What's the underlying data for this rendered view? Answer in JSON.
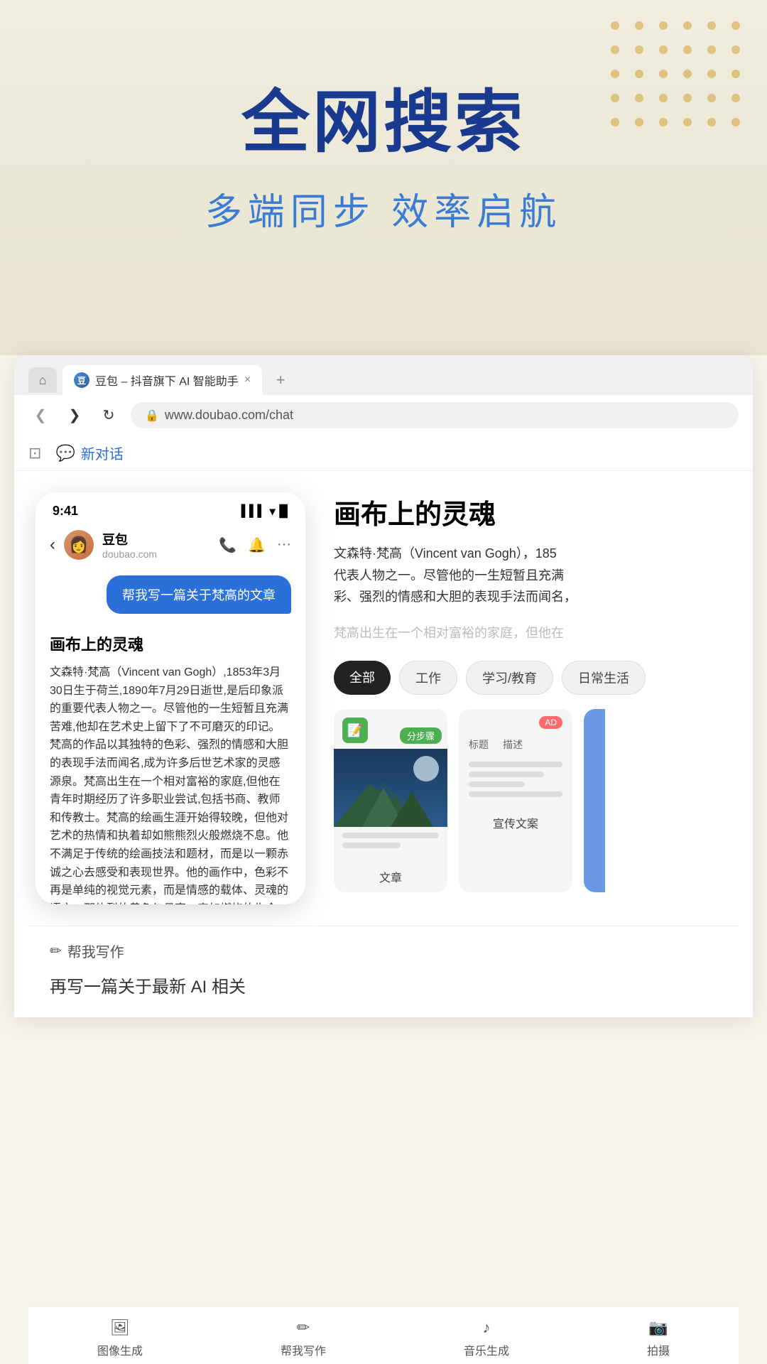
{
  "hero": {
    "title": "全网搜索",
    "subtitle": "多端同步 效率启航",
    "background_color": "#f0ede0"
  },
  "browser": {
    "tab": {
      "title": "豆包 – 抖音旗下 AI 智能助手",
      "favicon": "豆",
      "close_label": "×"
    },
    "new_tab_label": "+",
    "nav": {
      "back_label": "‹",
      "forward_label": "›",
      "refresh_label": "↺",
      "url": "www.doubao.com/chat",
      "lock_icon": "🔒"
    },
    "toolbar": {
      "sidebar_icon": "⊡",
      "new_chat_label": "新对话"
    }
  },
  "phone": {
    "status_bar": {
      "time": "9:41",
      "signal": "▌▌▌",
      "wifi": "▾",
      "battery": "▉"
    },
    "header": {
      "back_label": "‹",
      "contact_name": "豆包",
      "contact_url": "doubao.com"
    },
    "chat_bubble": "帮我写一篇关于梵高的文章",
    "article": {
      "title": "画布上的灵魂",
      "body": "文森特·梵高（Vincent van Gogh）,1853年3月30日生于荷兰,1890年7月29日逝世,是后印象派的重要代表人物之一。尽管他的一生短暂且充满苦难,他却在艺术史上留下了不可磨灭的印记。梵高的作品以其独特的色彩、强烈的情感和大胆的表现手法而闻名,成为许多后世艺术家的灵感源泉。梵高出生在一个相对富裕的家庭,但他在青年时期经历了许多职业尝试,包括书商、教师和传教士。梵高的绘画生涯开始得较晚，但他对艺术的热情和执着却如熊熊烈火般燃烧不息。他不满足于传统的绘画技法和题材，而是以一颗赤诚之心去感受和表现世界。他的画作中，色彩不再是单纯的视觉元素，而是情感的载体、灵魂的语言。那热烈的黄色与月亮，宛如燃烧的生命，仿佛在诉说着"
    }
  },
  "desktop": {
    "article": {
      "title": "画布上的灵魂",
      "body_line1": "文森特·梵高（Vincent van Gogh），185",
      "body_line2": "代表人物之一。尽管他的一生短暂且充满",
      "body_line3": "彩、强烈的情感和大胆的表现手法而闻名，",
      "body_faded": "梵高出生在一个相对富裕的家庭，但他在"
    },
    "tabs": [
      {
        "label": "全部",
        "active": true
      },
      {
        "label": "工作",
        "active": false
      },
      {
        "label": "学习/教育",
        "active": false
      },
      {
        "label": "日常生活",
        "active": false
      }
    ],
    "cards": [
      {
        "type": "image",
        "badge": "分步骤",
        "badge_color": "green",
        "label": "文章",
        "icon": "📝"
      },
      {
        "type": "ad",
        "badge": "AD",
        "badge_color": "red",
        "field1": "标题",
        "field2": "描述",
        "label": "宣传文案"
      }
    ]
  },
  "help_write": {
    "icon": "✏",
    "label": "帮我写作",
    "prompt": "再写一篇关于最新 AI 相关"
  },
  "bottom_nav": [
    {
      "icon": "🖼",
      "label": "图像生成"
    },
    {
      "icon": "✏",
      "label": "帮我写作"
    },
    {
      "icon": "♪",
      "label": "音乐生成"
    },
    {
      "icon": "📷",
      "label": "拍摄"
    }
  ],
  "accent_color": "#2b6fd9",
  "dots_color": "#d4a843"
}
